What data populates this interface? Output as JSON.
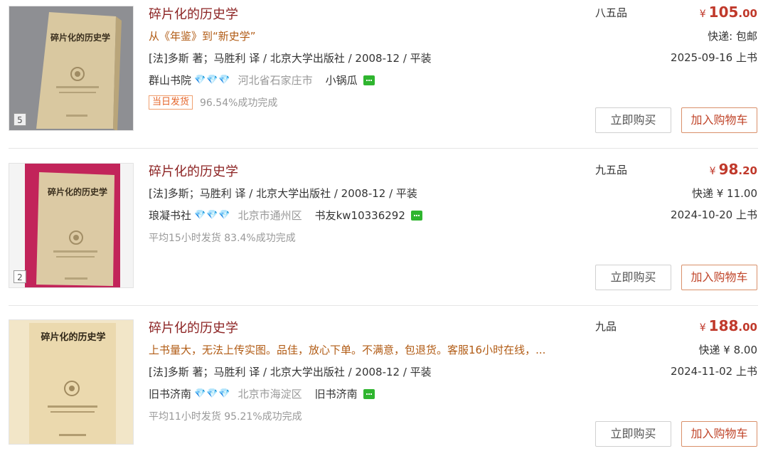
{
  "items": [
    {
      "title": "碎片化的历史学",
      "subtitle": "从《年鉴》到“新史学”",
      "meta": "[法]多斯 著；马胜利 译 / 北京大学出版社 / 2008-12 / 平装",
      "shop_name": "群山书院",
      "gems": "💎💎💎",
      "location": "河北省石家庄市",
      "seller": "小锅瓜",
      "tag": "当日发货",
      "stats": "96.54%成功完成",
      "condition": "八五品",
      "price_currency": "¥",
      "price_int": "105",
      "price_dec": ".00",
      "shipping": "快递: 包邮",
      "date": "2025-09-16 上书",
      "image_count": "5",
      "buy_label": "立即购买",
      "cart_label": "加入购物车",
      "cover_title": "碎片化的历史学"
    },
    {
      "title": "碎片化的历史学",
      "meta": "[法]多斯；马胜利 译 / 北京大学出版社 / 2008-12 / 平装",
      "shop_name": "琅凝书社",
      "gems": "💎💎💎",
      "location": "北京市通州区",
      "seller": "书友kw10336292",
      "stats": "平均15小时发货  83.4%成功完成",
      "condition": "九五品",
      "price_currency": "¥",
      "price_int": "98",
      "price_dec": ".20",
      "shipping": "快递 ¥ 11.00",
      "date": "2024-10-20 上书",
      "image_count": "2",
      "buy_label": "立即购买",
      "cart_label": "加入购物车",
      "cover_title": "碎片化的历史学"
    },
    {
      "title": "碎片化的历史学",
      "subtitle": "上书量大，无法上传实图。品佳，放心下单。不满意，包退货。客服16小时在线，...",
      "meta": "[法]多斯 著；马胜利 译 / 北京大学出版社 / 2008-12 / 平装",
      "shop_name": "旧书济南",
      "gems": "💎💎💎",
      "location": "北京市海淀区",
      "seller": "旧书济南",
      "stats": "平均11小时发货  95.21%成功完成",
      "condition": "九品",
      "price_currency": "¥",
      "price_int": "188",
      "price_dec": ".00",
      "shipping": "快递 ¥ 8.00",
      "date": "2024-11-02 上书",
      "buy_label": "立即购买",
      "cart_label": "加入购物车",
      "cover_title": "碎片化的历史学"
    }
  ],
  "colors": {
    "title": "#8c2323",
    "price": "#c0392b",
    "subtitle": "#b15b14",
    "chat": "#2fb52f"
  }
}
